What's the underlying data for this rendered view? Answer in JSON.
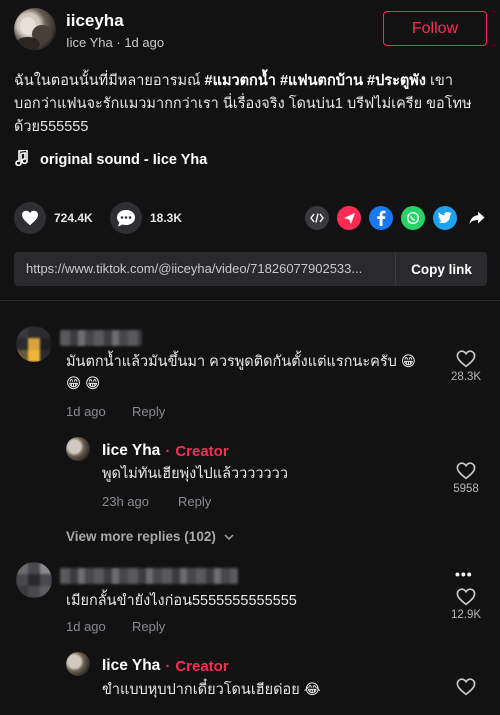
{
  "author": {
    "username": "iiceyha",
    "display_name": "Iice Yha",
    "time": "1d ago",
    "follow_label": "Follow"
  },
  "caption": {
    "line1_prefix": "ฉันในตอนนั้นที่มีหลายอารมณ์ ",
    "tag1": "#แมวตกน้ำ",
    "tag2": "#แฟนตกบ้าน",
    "tag3": "#ประตูพัง",
    "line1_suffix": " เขา",
    "line2": "บอกว่าแฟนจะรักแมวมากกว่าเรา นี่เรื่องจริง โดนบ่น1 บรีฟไม่เครีย ขอโทษ",
    "line3": "ด้วย555555"
  },
  "sound": {
    "label": "original sound - Iice Yha",
    "icon": "music-note-icon"
  },
  "actions": {
    "likes": "724.4K",
    "comments": "18.3K",
    "share_icons": [
      "embed-icon",
      "send-icon",
      "facebook-icon",
      "whatsapp-icon",
      "twitter-icon",
      "share-arrow-icon"
    ]
  },
  "link": {
    "url": "https://www.tiktok.com/@iiceyha/video/71826077902533...",
    "copy_label": "Copy link"
  },
  "comments": [
    {
      "text_line1": "มันตกน้ำแล้วมันขึ้นมา ควรพูดติดกันตั้งแต่แรกนะครับ 😁",
      "text_line2": "😁 😁",
      "time": "1d ago",
      "reply_label": "Reply",
      "likes": "28.3K",
      "replies": [
        {
          "name": "Iice Yha",
          "separator": "·",
          "badge": "Creator",
          "text": "พูดไม่ทันเฮียพุ่งไปแล้ววววววว",
          "time": "23h ago",
          "reply_label": "Reply",
          "likes": "5958"
        }
      ],
      "view_more": "View more replies (102)"
    },
    {
      "text_line1": "เมียกลั้นขำยังไงก่อน5555555555555",
      "time": "1d ago",
      "reply_label": "Reply",
      "likes": "12.9K",
      "more_icon": "•••",
      "replies": [
        {
          "name": "Iice Yha",
          "separator": "·",
          "badge": "Creator",
          "text": "ขำแบบหุบปากเดี๋ยวโดนเฮียด่อย 😂"
        }
      ]
    }
  ],
  "colors": {
    "background": "#121212",
    "accent": "#fe2c55",
    "muted": "#8a8b91"
  }
}
